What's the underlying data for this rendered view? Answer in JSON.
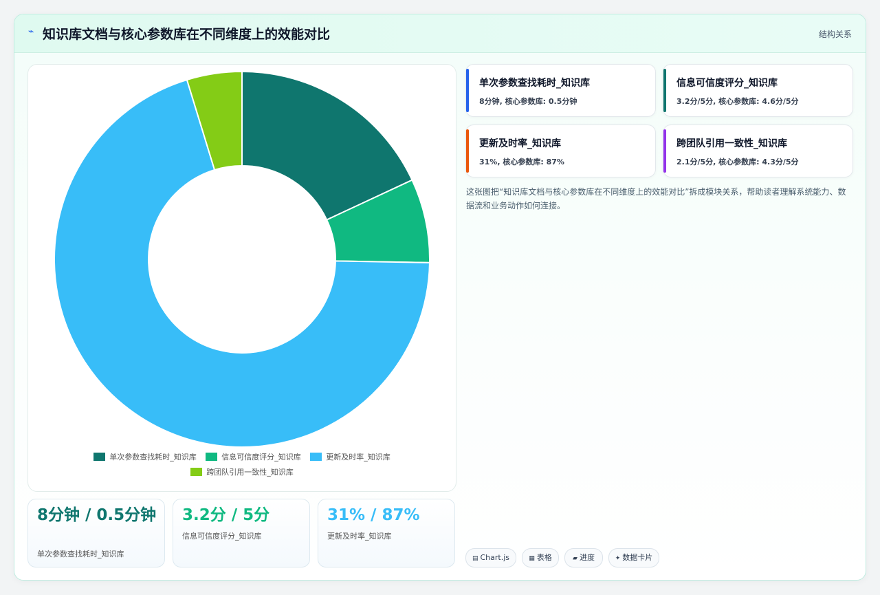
{
  "header": {
    "icon": "trend-icon",
    "title": "知识库文档与核心参数库在不同维度上的效能对比",
    "tag": "结构关系"
  },
  "chart_data": {
    "type": "doughnut",
    "categories": [
      "单次参数查找耗时_知识库",
      "信息可信度评分_知识库",
      "更新及时率_知识库",
      "跨团队引用一致性_知识库"
    ],
    "values": [
      8,
      3.2,
      31,
      2.1
    ],
    "colors": [
      "#0f766e",
      "#10b981",
      "#38bdf8",
      "#84cc16"
    ],
    "legend_position": "bottom"
  },
  "stats": [
    {
      "value": "8分钟 / 0.5分钟",
      "label": "单次参数查找耗时_知识库",
      "color": "#0f766e"
    },
    {
      "value": "3.2分 / 5分",
      "label": "信息可信度评分_知识库",
      "color": "#10b981"
    },
    {
      "value": "31% / 87%",
      "label": "更新及时率_知识库",
      "color": "#38bdf8"
    }
  ],
  "metrics": [
    {
      "title": "单次参数查找耗时_知识库",
      "sub": "8分钟, 核心参数库: 0.5分钟",
      "color": "#2563eb"
    },
    {
      "title": "信息可信度评分_知识库",
      "sub": "3.2分/5分, 核心参数库: 4.6分/5分",
      "color": "#0f766e"
    },
    {
      "title": "更新及时率_知识库",
      "sub": "31%, 核心参数库: 87%",
      "color": "#ea580c"
    },
    {
      "title": "跨团队引用一致性_知识库",
      "sub": "2.1分/5分, 核心参数库: 4.3分/5分",
      "color": "#9333ea"
    }
  ],
  "description": "这张图把“知识库文档与核心参数库在不同维度上的效能对比”拆成模块关系，帮助读者理解系统能力、数据流和业务动作如何连接。",
  "chips": [
    {
      "icon": "▤",
      "label": "Chart.js"
    },
    {
      "icon": "▦",
      "label": "表格"
    },
    {
      "icon": "▰",
      "label": "进度"
    },
    {
      "icon": "✦",
      "label": "数据卡片"
    }
  ]
}
